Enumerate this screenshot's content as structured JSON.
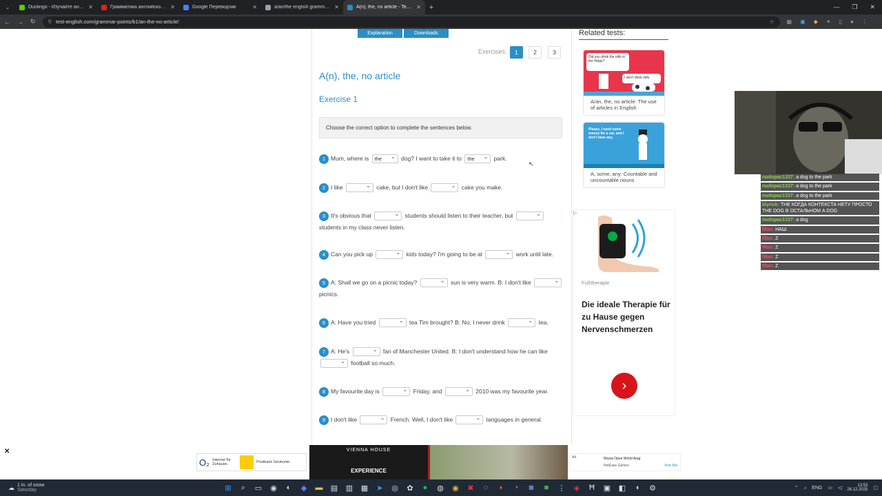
{
  "browser": {
    "tabs": [
      {
        "label": "Duolingo - Изучайте английск",
        "color": "#58cc02",
        "active": false
      },
      {
        "label": "Грамматика английского язы",
        "color": "#e62117",
        "active": false
      },
      {
        "label": "Google Переводчик",
        "color": "#4285f4",
        "active": false
      },
      {
        "label": "a/an/the english grammar gam",
        "color": "#9aa0a6",
        "active": false
      },
      {
        "label": "A(n), the, no article - Test-Engli",
        "color": "#2a8fc7",
        "active": true
      }
    ],
    "url": "test-english.com/grammar-points/b1/an-the-no-article/"
  },
  "page": {
    "top_buttons": [
      "Explanation",
      "Downloads"
    ],
    "exercises_label": "Exercises:",
    "exercise_numbers": [
      "1",
      "2",
      "3"
    ],
    "title": "A(n), the, no article",
    "exercise_title": "Exercise 1",
    "instruction": "Choose the correct option to complete the sentences below.",
    "questions": [
      {
        "num": "1",
        "t": [
          "Mum, where is",
          "dog? I want to take it to",
          "park."
        ],
        "sel": [
          "the",
          "the"
        ]
      },
      {
        "num": "2",
        "t": [
          "I like",
          "cake, but I don't like",
          "cake you make."
        ],
        "sel": [
          "",
          ""
        ]
      },
      {
        "num": "3",
        "t": [
          "It's obvious that",
          "students should listen to their teacher, but",
          "students in my class never listen."
        ],
        "sel": [
          "",
          ""
        ]
      },
      {
        "num": "4",
        "t": [
          "Can you pick up",
          "kids today? I'm going to be at",
          "work until late."
        ],
        "sel": [
          "",
          ""
        ]
      },
      {
        "num": "5",
        "t": [
          "A: Shall we go on a picnic today?",
          "sun is very warm. B: I don't like",
          "picnics."
        ],
        "sel": [
          "",
          ""
        ]
      },
      {
        "num": "6",
        "t": [
          "A: Have you tried",
          "tea Tim brought?  B: No, I never drink",
          "tea."
        ],
        "sel": [
          "",
          ""
        ]
      },
      {
        "num": "7",
        "t": [
          "A: He's",
          "fan of Manchester United.  B: I don't understand how he can like",
          "football so much."
        ],
        "sel": [
          "",
          ""
        ]
      },
      {
        "num": "8",
        "t": [
          "My favourite day is",
          "Friday, and",
          "2010 was my favourite year."
        ],
        "sel": [
          "",
          ""
        ]
      },
      {
        "num": "9",
        "t": [
          "I don't like",
          "French. Well, I don't like",
          "languages in general."
        ],
        "sel": [
          "",
          ""
        ]
      }
    ]
  },
  "related": {
    "heading": "Related tests:",
    "cards": [
      {
        "bubble_a": "Did you drink the milk in the fridge?",
        "bubble_b": "I don't drink milk.",
        "caption": "A/an, the, no article: The use of articles in English"
      },
      {
        "bubble_a": "Please, I need some money for a car, and I don't have any.",
        "bubble_b": "",
        "caption": "A, some, any: Countable and uncountable nouns"
      }
    ]
  },
  "ad": {
    "source": "Fußtherapie",
    "headline": "Die ideale Therapie für zu Hause gegen Nervenschmerzen",
    "arrow": "›"
  },
  "chat": [
    {
      "user": "nudopac1337:",
      "color": "#8fd14f",
      "msg": "a dog to the park"
    },
    {
      "user": "nudopac1337:",
      "color": "#8fd14f",
      "msg": "a dog to the park"
    },
    {
      "user": "nudopac1337:",
      "color": "#8fd14f",
      "msg": "a dog to the park"
    },
    {
      "user": "blyrick:",
      "color": "#8fd14f",
      "msg": "THE КОГДА КОНТЕКСТА НЕТУ ПРОСТО THE DOG В ОСТАЛЬНОМ A DOG"
    },
    {
      "user": "nudopac1337:",
      "color": "#8fd14f",
      "msg": "a dog"
    },
    {
      "user": "fifan:",
      "color": "#ff4a6b",
      "msg": "НАШ"
    },
    {
      "user": "fifan:",
      "color": "#ff4a6b",
      "msg": "Z"
    },
    {
      "user": "fifan:",
      "color": "#ff4a6b",
      "msg": "Z"
    },
    {
      "user": "fifan:",
      "color": "#ff4a6b",
      "msg": "Z"
    },
    {
      "user": "fifan:",
      "color": "#ff4a6b",
      "msg": "Z"
    }
  ],
  "bottom_ads": {
    "o2_text": "Internet für Zuhause.",
    "postbank_text": "Postbank Girokonto",
    "hotel_name": "VIENNA HOUSE",
    "hotel_cta": "EXPERIENCE",
    "small_ad_title": "Wuxia Open World Arpg",
    "small_ad_sub": "NetEase Games",
    "small_ad_link": "Visit Site"
  },
  "taskbar": {
    "weather": "1 in. of snow",
    "weather_sub": "Saturday",
    "lang": "ENG",
    "time": "13:53",
    "date": "26.12.2025"
  }
}
